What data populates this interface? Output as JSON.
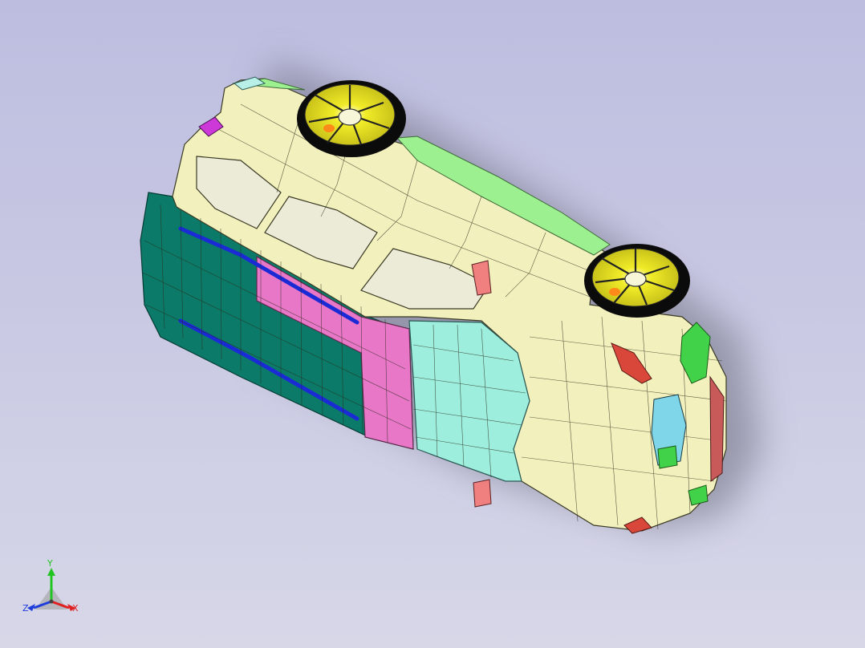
{
  "viewport": {
    "background_top": "#bdbde0",
    "background_bottom": "#d7d7e8"
  },
  "model": {
    "colors": {
      "body": "#f2f0bc",
      "side_panel": "#0b7a68",
      "door_pink": "#e877c8",
      "hood_cyan": "#9eeede",
      "roof_strip": "#9cf08f",
      "trim": "#1a2bd6",
      "light_red": "#d8473a",
      "light_green": "#42d24a",
      "mirror": "#f07f7f",
      "tire": "#0b0b0b",
      "rim": "#f1ec28",
      "glass": "#ebebd8",
      "shadow": "#6c6c7e",
      "mesh_line": "#2a2a1a"
    }
  },
  "triad": {
    "y_label": "Y",
    "x_label": "X",
    "z_label": "Z",
    "y_color": "#22c422",
    "x_color": "#e02020",
    "z_color": "#1f3ddb"
  }
}
